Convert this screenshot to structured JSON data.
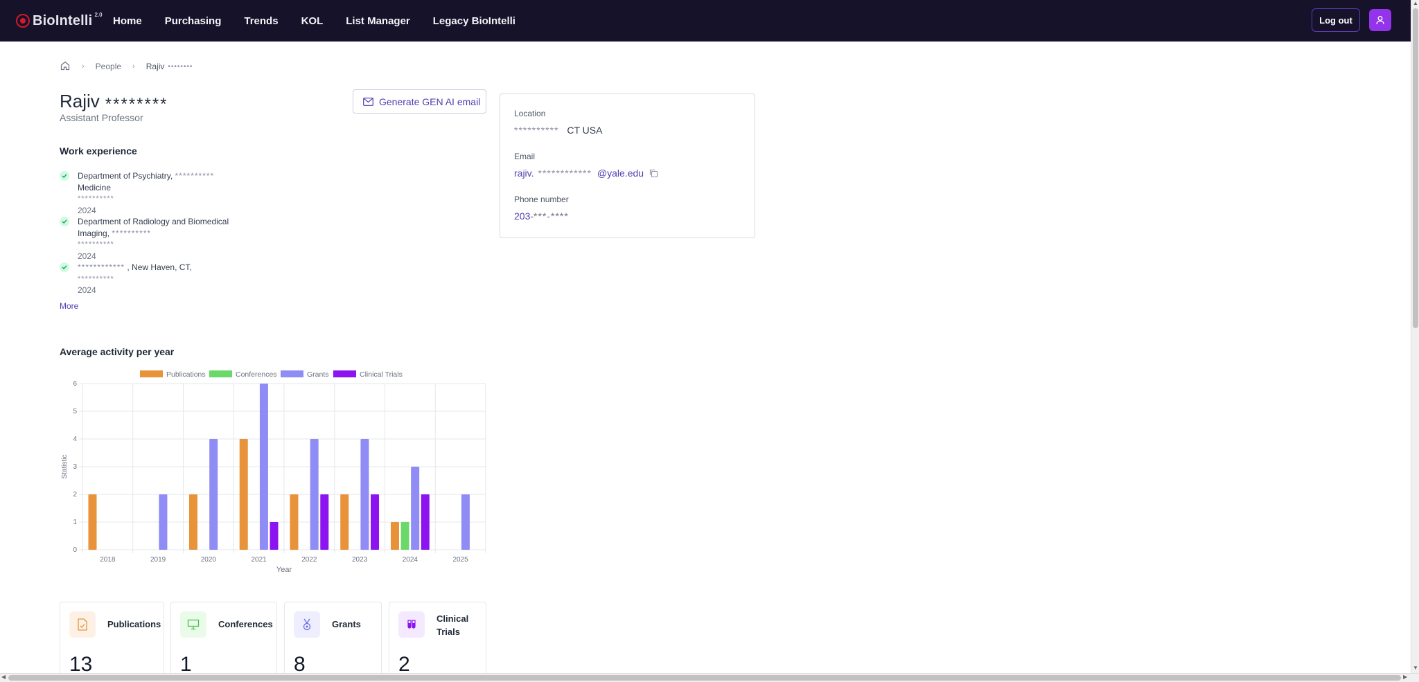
{
  "nav": {
    "logo_text": "BioIntelli",
    "logo_version": "2.0",
    "links": [
      "Home",
      "Purchasing",
      "Trends",
      "KOL",
      "List Manager",
      "Legacy BioIntelli"
    ],
    "logout_label": "Log out"
  },
  "breadcrumb": {
    "items": [
      "People"
    ],
    "current": "Rajiv",
    "current_masked": "••••••••"
  },
  "profile": {
    "first_name": "Rajiv",
    "last_name_masked": "********",
    "title": "Assistant Professor",
    "genai_button": "Generate GEN AI email"
  },
  "work_experience": {
    "heading": "Work experience",
    "items": [
      {
        "line1": "Department of Psychiatry,",
        "line1_masked": "**********",
        "line2": "Medicine",
        "sub_masked": "**********",
        "year": "2024"
      },
      {
        "line1": "Department of Radiology and Biomedical",
        "line2": "Imaging,",
        "line2_masked": "**********",
        "sub_masked": "**********",
        "year": "2024"
      },
      {
        "line1_masked": "************",
        "line1": ", New Haven, CT,",
        "sub_masked": "**********",
        "year": "2024"
      }
    ],
    "more_label": "More"
  },
  "contact": {
    "location_label": "Location",
    "location_masked": "**********",
    "location_value": "CT USA",
    "email_label": "Email",
    "email_prefix": "rajiv.",
    "email_masked": "************",
    "email_domain": "@yale.edu",
    "phone_label": "Phone number",
    "phone_prefix": "203-",
    "phone_masked": "***-****"
  },
  "activity": {
    "heading": "Average activity per year"
  },
  "chart_data": {
    "type": "bar",
    "categories": [
      "2018",
      "2019",
      "2020",
      "2021",
      "2022",
      "2023",
      "2024",
      "2025"
    ],
    "series": [
      {
        "name": "Publications",
        "color": "#e8923a",
        "values": [
          2,
          0,
          2,
          4,
          2,
          2,
          1,
          0
        ]
      },
      {
        "name": "Conferences",
        "color": "#6ad96a",
        "values": [
          0,
          0,
          0,
          0,
          0,
          0,
          1,
          0
        ]
      },
      {
        "name": "Grants",
        "color": "#8f8cf5",
        "values": [
          0,
          2,
          4,
          6,
          4,
          4,
          3,
          2
        ]
      },
      {
        "name": "Clinical Trials",
        "color": "#8b14f0",
        "values": [
          0,
          0,
          0,
          1,
          2,
          2,
          2,
          0
        ]
      }
    ],
    "xlabel": "Year",
    "ylabel": "Statistic",
    "ylim": [
      0,
      6
    ],
    "yticks": [
      "0",
      "1",
      "2",
      "3",
      "4",
      "5",
      "6"
    ],
    "grid": true,
    "legend_position": "top"
  },
  "stats": [
    {
      "label": "Publications",
      "value": "13",
      "icon": "document-icon",
      "color": "#e8923a",
      "bg": "#fdf1e6"
    },
    {
      "label": "Conferences",
      "value": "1",
      "icon": "presentation-icon",
      "color": "#4cc04c",
      "bg": "#eafbea"
    },
    {
      "label": "Grants",
      "value": "8",
      "icon": "medal-icon",
      "color": "#6d6ae8",
      "bg": "#eeeefe"
    },
    {
      "label": "Clinical Trials",
      "label_lines": [
        "Clinical",
        "Trials"
      ],
      "value": "2",
      "icon": "test-tubes-icon",
      "color": "#8b14f0",
      "bg": "#f4e9fe"
    }
  ]
}
